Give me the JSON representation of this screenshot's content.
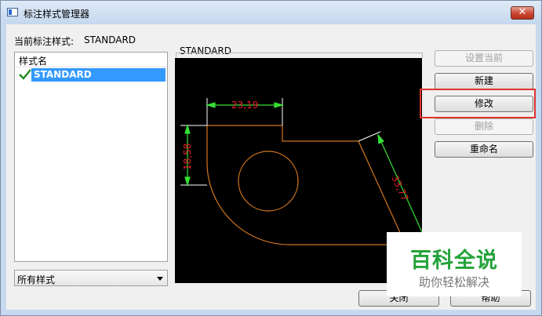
{
  "window": {
    "title": "标注样式管理器",
    "close_label": "✕"
  },
  "current_style": {
    "label": "当前标注样式:",
    "value": "STANDARD"
  },
  "styles_list": {
    "header": "样式名",
    "items": [
      {
        "label": "STANDARD",
        "selected": true,
        "current": true
      }
    ]
  },
  "list_filter": {
    "selected": "所有样式"
  },
  "preview": {
    "label": "STANDARD",
    "dimensions": {
      "horizontal": "23,19",
      "vertical": "18,58",
      "aligned": "33,77"
    },
    "colors": {
      "background": "#000000",
      "geometry": "#d3761f",
      "extension": "#ffffff",
      "dim_line": "#35e035",
      "dim_text": "#e8202a"
    }
  },
  "buttons": {
    "set_current": "设置当前",
    "new": "新建",
    "modify": "修改",
    "delete": "删除",
    "rename": "重命名",
    "close": "关闭",
    "help": "帮助"
  },
  "watermark": {
    "title": "百科全说",
    "subtitle": "助你轻松解决"
  },
  "colors": {
    "selection": "#3399ff",
    "highlight_box": "#e0342b",
    "watermark_green": "#23a33a"
  }
}
